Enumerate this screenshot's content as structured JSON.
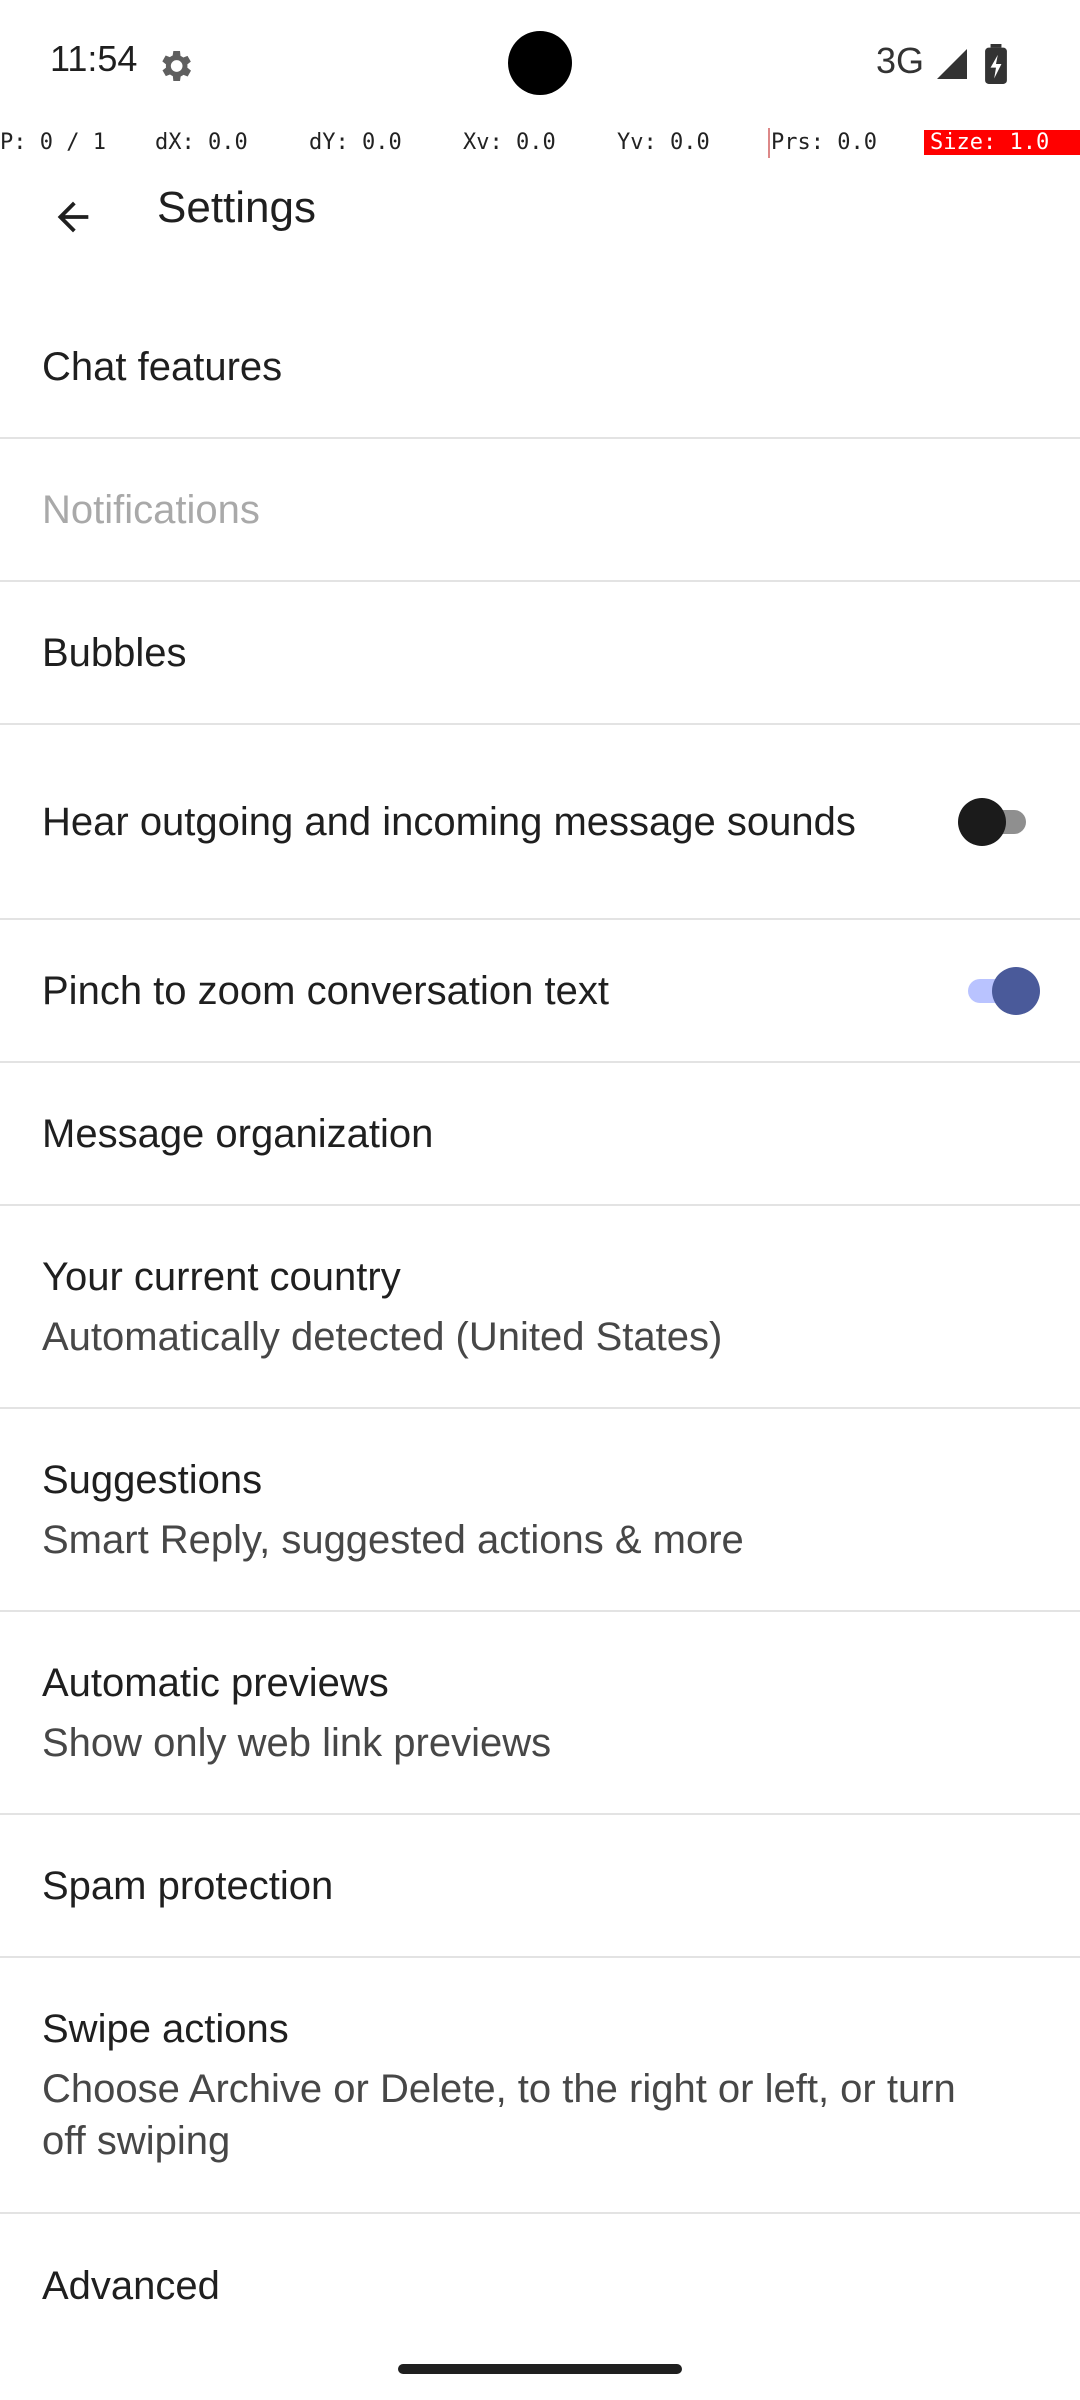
{
  "status_bar": {
    "time": "11:54",
    "network": "3G",
    "settings_icon": "gear-icon",
    "signal_icon": "signal-icon",
    "battery_icon": "battery-icon"
  },
  "pointer_overlay": {
    "p": "P: 0 / 1",
    "dx": "dX: 0.0",
    "dy": "dY: 0.0",
    "xv": "Xv: 0.0",
    "yv": "Yv: 0.0",
    "prs": "Prs: 0.0",
    "size": "Size: 1.0"
  },
  "app_bar": {
    "back_icon": "arrow-back-icon",
    "title": "Settings"
  },
  "settings": {
    "chat_features": {
      "title": "Chat features"
    },
    "notifications": {
      "title": "Notifications",
      "enabled": false
    },
    "bubbles": {
      "title": "Bubbles"
    },
    "message_sounds": {
      "title": "Hear outgoing and incoming message sounds",
      "checked": false
    },
    "pinch_zoom": {
      "title": "Pinch to zoom conversation text",
      "checked": true
    },
    "message_organization": {
      "title": "Message organization"
    },
    "current_country": {
      "title": "Your current country",
      "summary": "Automatically detected (United States)"
    },
    "suggestions": {
      "title": "Suggestions",
      "summary": "Smart Reply, suggested actions & more"
    },
    "automatic_previews": {
      "title": "Automatic previews",
      "summary": "Show only web link previews"
    },
    "spam_protection": {
      "title": "Spam protection"
    },
    "swipe_actions": {
      "title": "Swipe actions",
      "summary": "Choose Archive or Delete, to the right or left, or turn off swiping"
    },
    "advanced": {
      "title": "Advanced"
    }
  },
  "colors": {
    "switch_on_thumb": "#4a5a9a",
    "switch_on_track": "#b9c3ff",
    "switch_off_thumb": "#1b1b1b",
    "switch_off_track": "#8f8f8f",
    "overlay_highlight": "#ff0000"
  }
}
